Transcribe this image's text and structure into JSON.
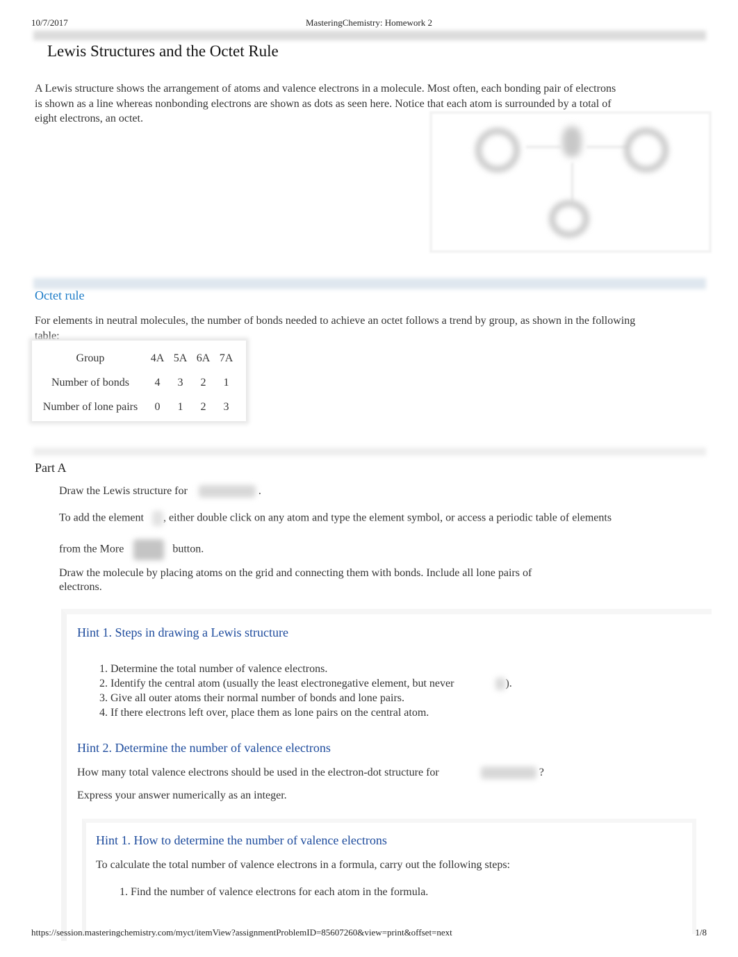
{
  "print_header": {
    "date": "10/7/2017",
    "title": "MasteringChemistry: Homework 2"
  },
  "main": {
    "title": "Lewis Structures and the Octet Rule",
    "intro": "A Lewis structure shows the arrangement of atoms and valence electrons in a molecule. Most often, each bonding pair of electrons is shown as a line whereas nonbonding electrons are shown as dots as seen here. Notice that each atom is surrounded by a total of eight electrons, an octet.",
    "figure_icon": "lewis-structure-diagram-icon"
  },
  "octet_rule": {
    "heading": "Octet rule",
    "text": "For elements in neutral molecules, the number of bonds needed to achieve an octet follows a trend by group, as shown in the following table:",
    "table": {
      "headers": [
        "Group",
        "4A",
        "5A",
        "6A",
        "7A"
      ],
      "rows": [
        [
          "Number of bonds",
          "4",
          "3",
          "2",
          "1"
        ],
        [
          "Number of lone pairs",
          "0",
          "1",
          "2",
          "3"
        ]
      ]
    }
  },
  "part_a": {
    "label": "Part A",
    "p1_prefix": "Draw the Lewis structure for",
    "p1_suffix": ".",
    "p2_prefix": "To add the element",
    "p2_suffix": ", either double click on any atom and type the element symbol, or access a periodic table of elements",
    "p3_prefix": "from the More",
    "p3_suffix": "button.",
    "p4": "Draw the molecule by placing atoms on the grid and connecting them with bonds. Include all lone pairs of electrons."
  },
  "hints": {
    "hint1_title": "Hint 1.  Steps in drawing a Lewis structure",
    "hint1_steps": [
      "1. Determine the total number of valence electrons.",
      "2. Identify the central atom (usually the least electronegative element, but never",
      "3. Give all outer atoms their normal number of bonds and lone pairs.",
      "4. If there electrons left over, place them as lone pairs on the central atom."
    ],
    "hint1_step2_suffix": ").",
    "hint2_title": "Hint 2.  Determine the number of valence electrons",
    "hint2_question_prefix": "How many total valence electrons should be used in the electron-dot structure for",
    "hint2_question_suffix": "?",
    "hint2_instruction": "Express your answer numerically as an integer.",
    "sub_hint1_title": "Hint 1.  How to determine the number of valence electrons",
    "sub_hint1_text": "To calculate the total number of valence electrons in a formula, carry out the following steps:",
    "sub_hint1_steps": [
      "1. Find the number of valence electrons for each atom in the formula."
    ]
  },
  "footer": {
    "url": "https://session.masteringchemistry.com/myct/itemView?assignmentProblemID=85607260&view=print&offset=next",
    "page": "1/8"
  }
}
